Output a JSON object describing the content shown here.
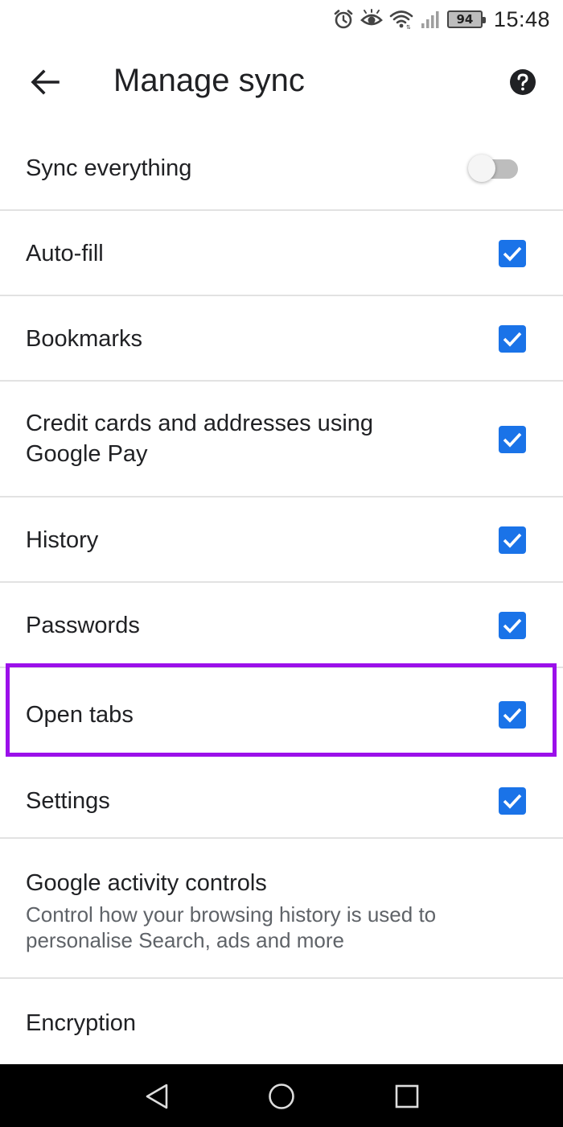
{
  "status_bar": {
    "battery": "94",
    "time": "15:48",
    "icons": [
      "alarm-icon",
      "eye-comfort-icon",
      "wifi-icon",
      "signal-icon",
      "battery-icon"
    ]
  },
  "app_bar": {
    "title": "Manage sync",
    "back_icon": "arrow-back-icon",
    "help_icon": "help-icon"
  },
  "sync_everything": {
    "label": "Sync everything",
    "enabled": false
  },
  "items": [
    {
      "label": "Auto-fill",
      "checked": true
    },
    {
      "label": "Bookmarks",
      "checked": true
    },
    {
      "label": "Credit cards and addresses using",
      "label_line2": "Google Pay",
      "checked": true
    },
    {
      "label": "History",
      "checked": true
    },
    {
      "label": "Passwords",
      "checked": true
    },
    {
      "label": "Open tabs",
      "checked": true,
      "highlighted": true
    },
    {
      "label": "Settings",
      "checked": true
    }
  ],
  "activity_controls": {
    "title": "Google activity controls",
    "description_line1": "Control how your browsing history is used to",
    "description_line2": "personalise Search, ads and more"
  },
  "encryption": {
    "label": "Encryption"
  },
  "colors": {
    "accent": "#1a73e8",
    "highlight": "#9b10ea",
    "nav_bar": "#000000"
  },
  "nav_bar": {
    "icons": [
      "back-triangle-icon",
      "home-circle-icon",
      "recents-square-icon"
    ]
  }
}
